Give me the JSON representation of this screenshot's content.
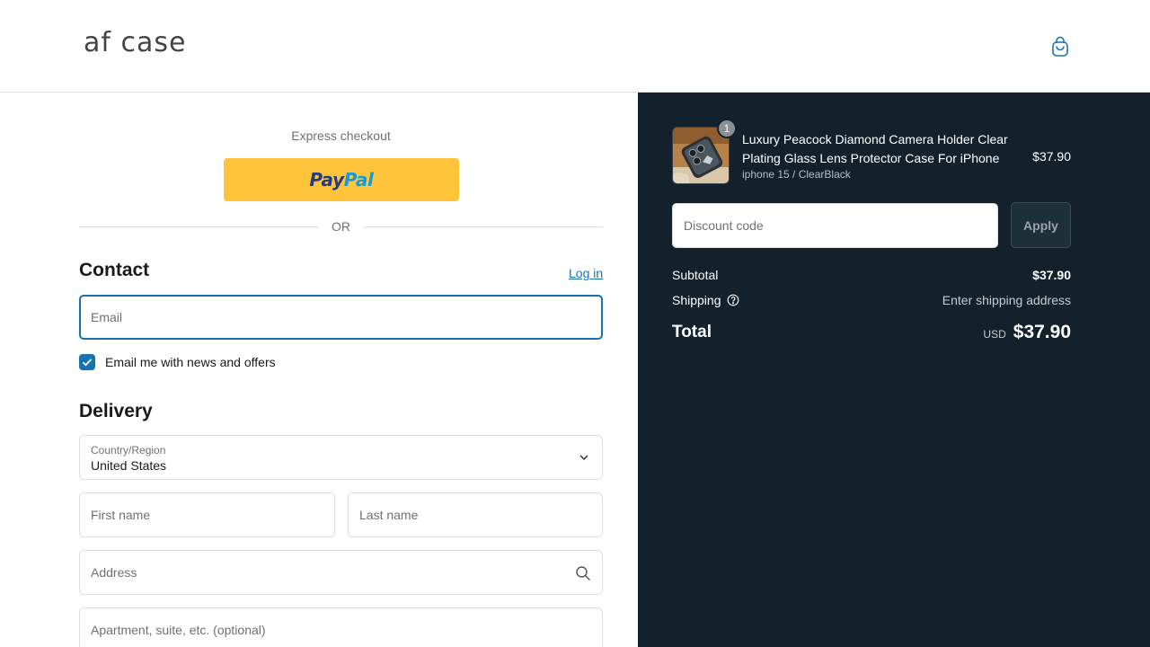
{
  "header": {
    "logo_text": "af case",
    "cart_icon": "shopping-bag-icon"
  },
  "express": {
    "label": "Express checkout",
    "paypal_pay": "Pay",
    "paypal_pal": "Pal",
    "or": "OR"
  },
  "contact": {
    "title": "Contact",
    "login_label": "Log in",
    "email_placeholder": "Email",
    "news_label": "Email me with news and offers",
    "news_checked": true
  },
  "delivery": {
    "title": "Delivery",
    "country_label": "Country/Region",
    "country_value": "United States",
    "first_name_placeholder": "First name",
    "last_name_placeholder": "Last name",
    "address_placeholder": "Address",
    "apartment_placeholder": "Apartment, suite, etc. (optional)"
  },
  "summary": {
    "product": {
      "title": "Luxury Peacock Diamond Camera Holder Clear Plating Glass Lens Protector Case For iPhone",
      "variant": "iphone 15 / ClearBlack",
      "price": "$37.90",
      "quantity": "1"
    },
    "discount_placeholder": "Discount code",
    "apply_label": "Apply",
    "subtotal_label": "Subtotal",
    "subtotal_value": "$37.90",
    "shipping_label": "Shipping",
    "shipping_value": "Enter shipping address",
    "total_label": "Total",
    "currency": "USD",
    "total_value": "$37.90"
  },
  "colors": {
    "accent": "#1773b0",
    "summary_bg": "#13212c",
    "paypal_yellow": "#ffc439"
  }
}
